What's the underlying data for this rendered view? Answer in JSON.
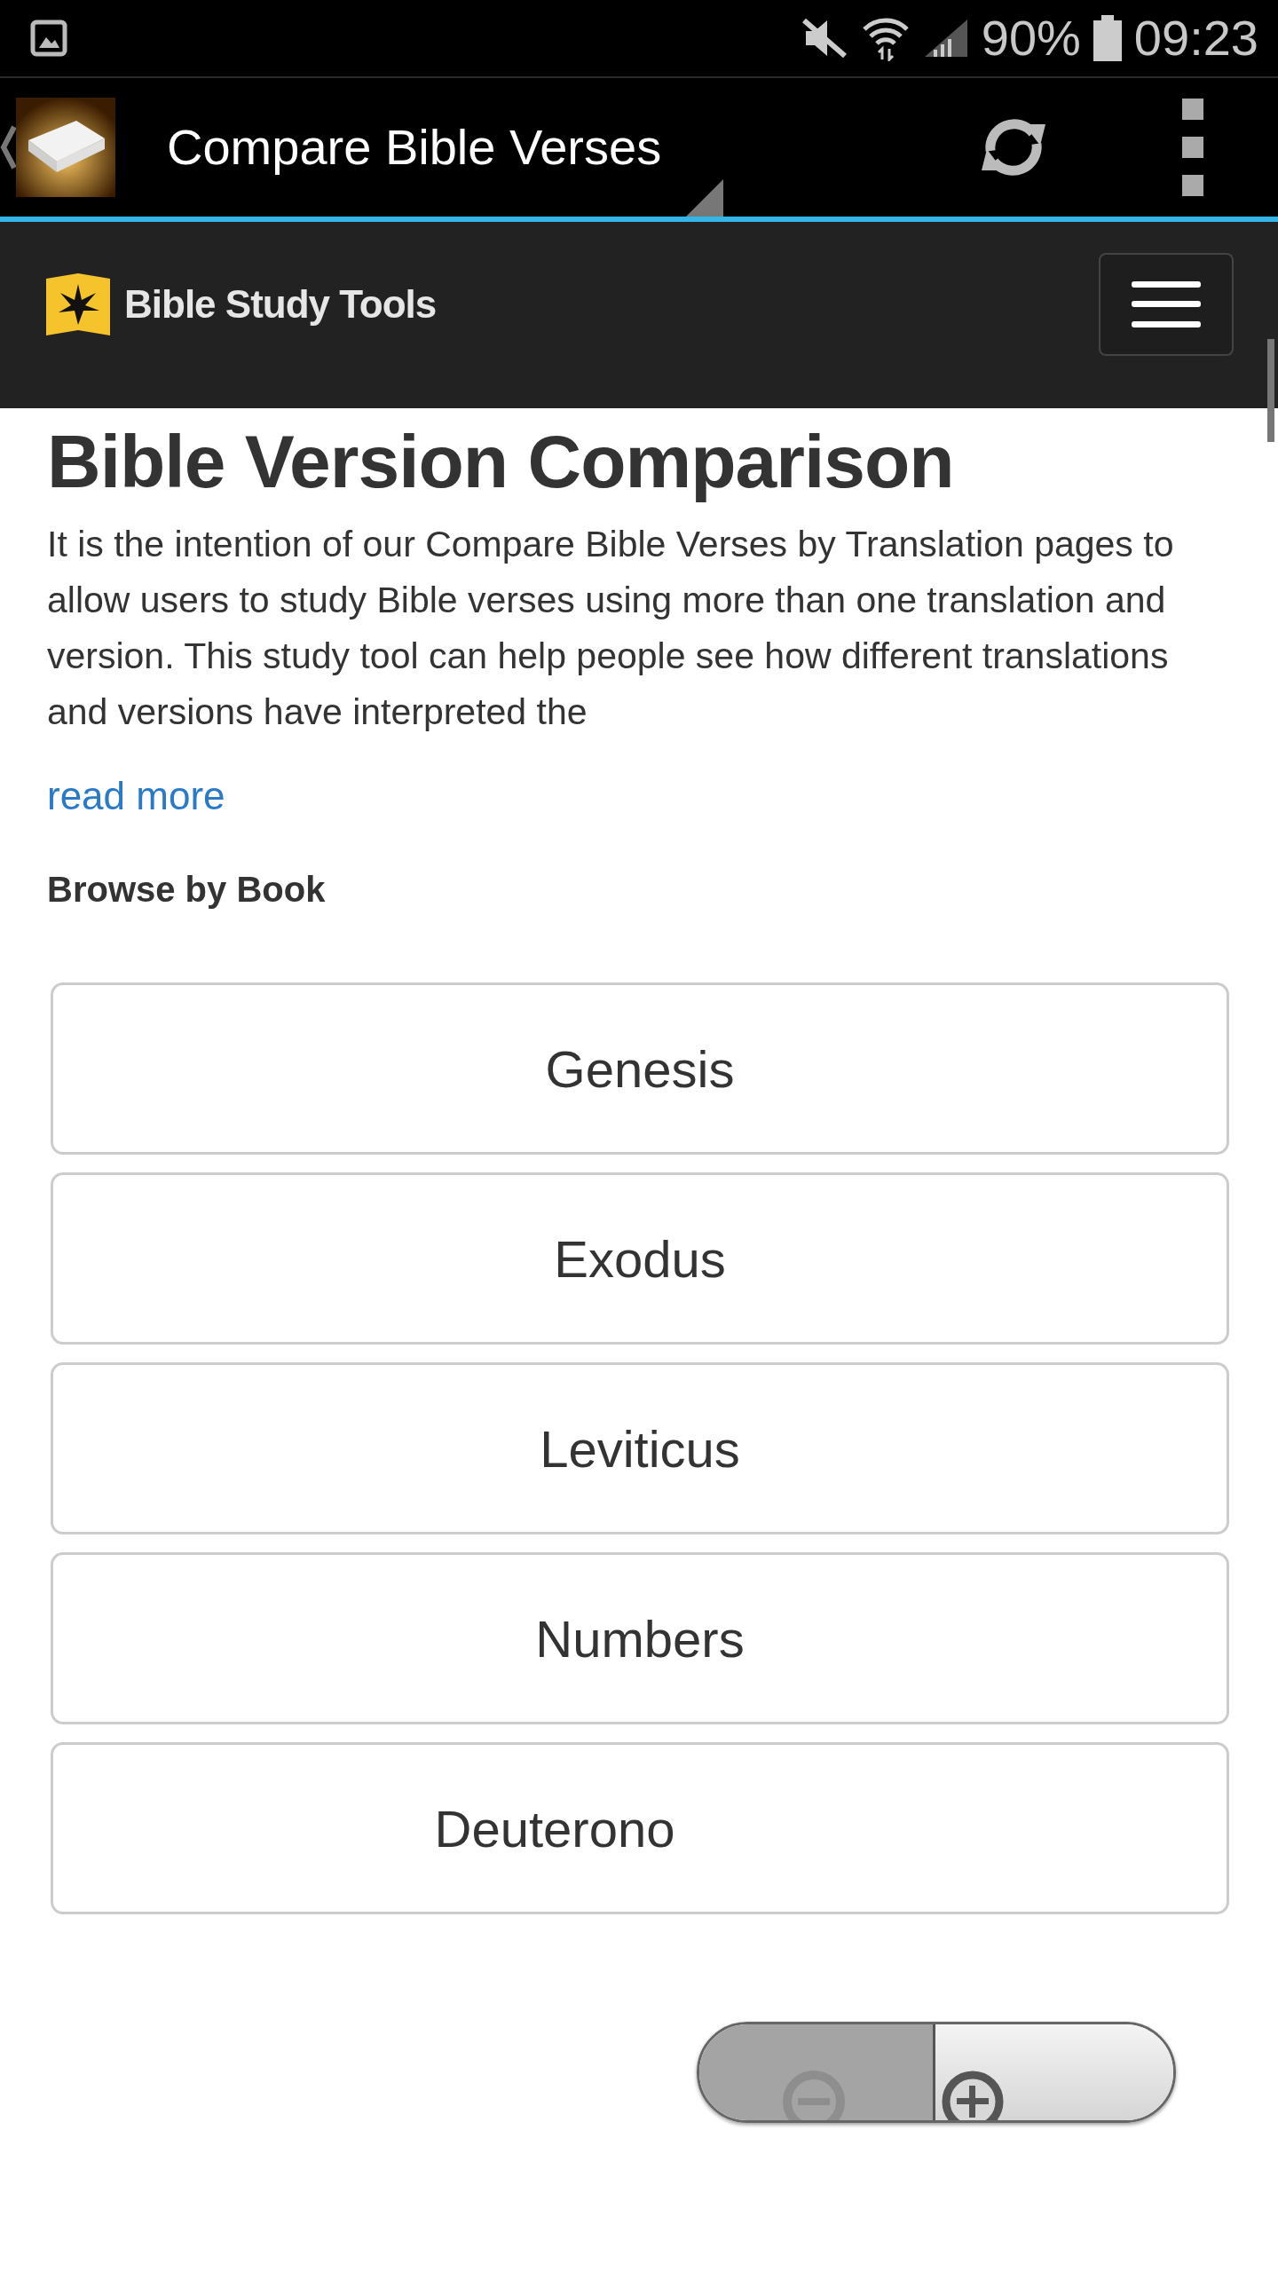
{
  "status_bar": {
    "battery": "90%",
    "time": "09:23"
  },
  "app_bar": {
    "title": "Compare Bible Verses"
  },
  "site_header": {
    "logo_text": "Bible Study Tools"
  },
  "article": {
    "title": "Bible Version Comparison",
    "intro": "It is the intention of our Compare Bible Verses by Translation pages to allow users to study Bible verses using more than one translation and version. This study tool can help people see how different translations and versions have interpreted the",
    "read_more": "read more"
  },
  "browse": {
    "heading": "Browse by Book",
    "books": [
      {
        "label": "Genesis"
      },
      {
        "label": "Exodus"
      },
      {
        "label": "Leviticus"
      },
      {
        "label": "Numbers"
      },
      {
        "label": "Deuterono"
      }
    ]
  }
}
